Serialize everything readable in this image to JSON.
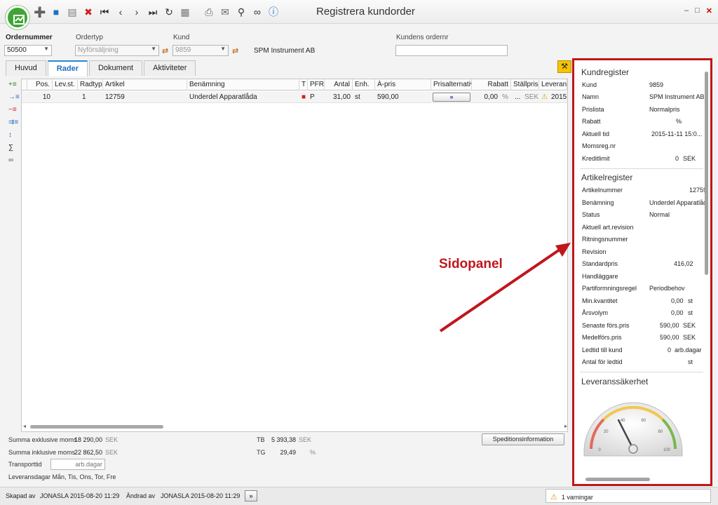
{
  "window": {
    "title": "Registrera kundorder",
    "controls": {
      "minimize": "–",
      "maximize": "□",
      "close": "✕"
    }
  },
  "toolbar": {
    "icons": [
      "new-icon",
      "save-icon",
      "print-preview-icon",
      "delete-icon",
      "first-record-icon",
      "previous-record-icon",
      "next-record-icon",
      "last-record-icon",
      "refresh-icon",
      "clipboard-icon",
      "print-icon",
      "email-icon",
      "search-icon",
      "link-icon",
      "help-icon"
    ]
  },
  "header": {
    "ordernummer_label": "Ordernummer",
    "ordernummer_value": "50500",
    "ordertyp_label": "Ordertyp",
    "ordertyp_value": "Nyförsäljning",
    "kund_label": "Kund",
    "kund_value": "9859",
    "kund_name": "SPM Instrument AB",
    "kundens_ordernr_label": "Kundens ordernr",
    "kundens_ordernr_value": ""
  },
  "tabs": [
    {
      "label": "Huvud",
      "active": false
    },
    {
      "label": "Rader",
      "active": true
    },
    {
      "label": "Dokument",
      "active": false
    },
    {
      "label": "Aktiviteter",
      "active": false
    }
  ],
  "grid": {
    "columns": [
      "Pos.",
      "Lev.st.",
      "Radtyp",
      "Artikel",
      "Benämning",
      "T",
      "PFR",
      "Antal",
      "Enh.",
      "À-pris",
      "Prisalternativ",
      "Rabatt",
      "Ställpris",
      "Leveransd"
    ],
    "rows": [
      {
        "pos": "10",
        "levst": "",
        "radtyp": "1",
        "artikel": "12759",
        "benamning": "Underdel Apparatlåda",
        "pfr": "P",
        "antal": "31,00",
        "enh": "st",
        "apris": "590,00",
        "prisalternativ": "»",
        "rabatt": "0,00",
        "rabatt_unit": "%",
        "stallpris": "...",
        "stallpris_unit": "SEK",
        "leveransdatum": "2015"
      }
    ]
  },
  "summary": {
    "excl_label": "Summa exklusive moms",
    "excl_value": "18 290,00",
    "excl_unit": "SEK",
    "incl_label": "Summa inklusive moms",
    "incl_value": "22 862,50",
    "incl_unit": "SEK",
    "transport_label": "Transporttid",
    "transport_placeholder": "arb.dagar",
    "leveransdagar": "Leveransdagar Mån, Tis, Ons, Tor, Fre",
    "tb_label": "TB",
    "tb_value": "5 393,38",
    "tb_unit": "SEK",
    "tg_label": "TG",
    "tg_value": "29,49",
    "tg_unit": "%",
    "spedition_button": "Speditionsinformation"
  },
  "statusbar": {
    "skapad_label": "Skapad av",
    "skapad_value": "JONASLA 2015-08-20 11:29",
    "andrad_label": "Ändrad av",
    "andrad_value": "JONASLA 2015-08-20 11:29",
    "nav_button": "»",
    "warnings": "1 varningar"
  },
  "sidepanel": {
    "kundregister": {
      "title": "Kundregister",
      "kund_label": "Kund",
      "kund_value": "9859",
      "namn_label": "Namn",
      "namn_value": "SPM Instrument AB",
      "prislista_label": "Prislista",
      "prislista_value": "Normalpris",
      "rabatt_label": "Rabatt",
      "rabatt_unit": "%",
      "aktuell_tid_label": "Aktuell tid",
      "aktuell_tid_value": "2015-11-11 15:0...",
      "momsreg_label": "Momsreg.nr",
      "kreditlimit_label": "Kreditlimit",
      "kreditlimit_value": "0",
      "kreditlimit_unit": "SEK"
    },
    "artikelregister": {
      "title": "Artikelregister",
      "artikelnummer_label": "Artikelnummer",
      "artikelnummer_value": "12759",
      "benamning_label": "Benämning",
      "benamning_value": "Underdel Apparatlåd",
      "status_label": "Status",
      "status_value": "Normal",
      "aktuell_rev_label": "Aktuell art.revision",
      "ritningsnummer_label": "Ritningsnummer",
      "revision_label": "Revision",
      "standardpris_label": "Standardpris",
      "standardpris_value": "416,02",
      "handlaggare_label": "Handläggare",
      "partiformning_label": "Partiformningsregel",
      "partiformning_value": "Periodbehov",
      "minkvantitet_label": "Min.kvantitet",
      "minkvantitet_value": "0,00",
      "minkvantitet_unit": "st",
      "arsvolym_label": "Årsvolym",
      "arsvolym_value": "0,00",
      "arsvolym_unit": "st",
      "senaste_label": "Senaste förs.pris",
      "senaste_value": "590,00",
      "senaste_unit": "SEK",
      "medel_label": "Medelförs.pris",
      "medel_value": "590,00",
      "medel_unit": "SEK",
      "ledtid_label": "Ledtid till kund",
      "ledtid_value": "0",
      "ledtid_unit": "arb.dagar",
      "antal_ledtid_label": "Antal för ledtid",
      "antal_ledtid_unit": "st"
    },
    "leveranssakerhet": {
      "title": "Leveranssäkerhet",
      "gauge_value": 35,
      "gauge_ticks": [
        "0",
        "20",
        "40",
        "60",
        "80",
        "100"
      ]
    }
  },
  "annotation": {
    "label": "Sidopanel",
    "color": "#c0161c"
  },
  "colors": {
    "accent": "#2b86d9",
    "logo": "#3fa535",
    "highlight": "#c0161c"
  }
}
